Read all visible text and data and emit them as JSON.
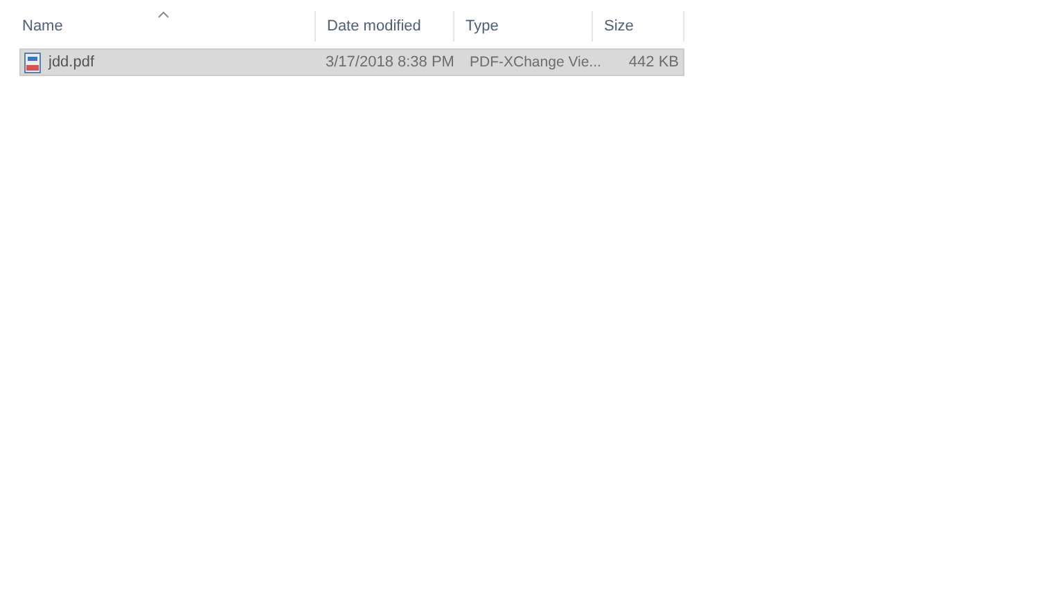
{
  "table": {
    "columns": [
      {
        "label": "Name",
        "sorted": true
      },
      {
        "label": "Date modified",
        "sorted": false
      },
      {
        "label": "Type",
        "sorted": false
      },
      {
        "label": "Size",
        "sorted": false
      }
    ],
    "rows": [
      {
        "name": "jdd.pdf",
        "date_modified": "3/17/2018 8:38 PM",
        "type": "PDF-XChange Vie...",
        "size": "442 KB",
        "selected": true
      }
    ]
  }
}
